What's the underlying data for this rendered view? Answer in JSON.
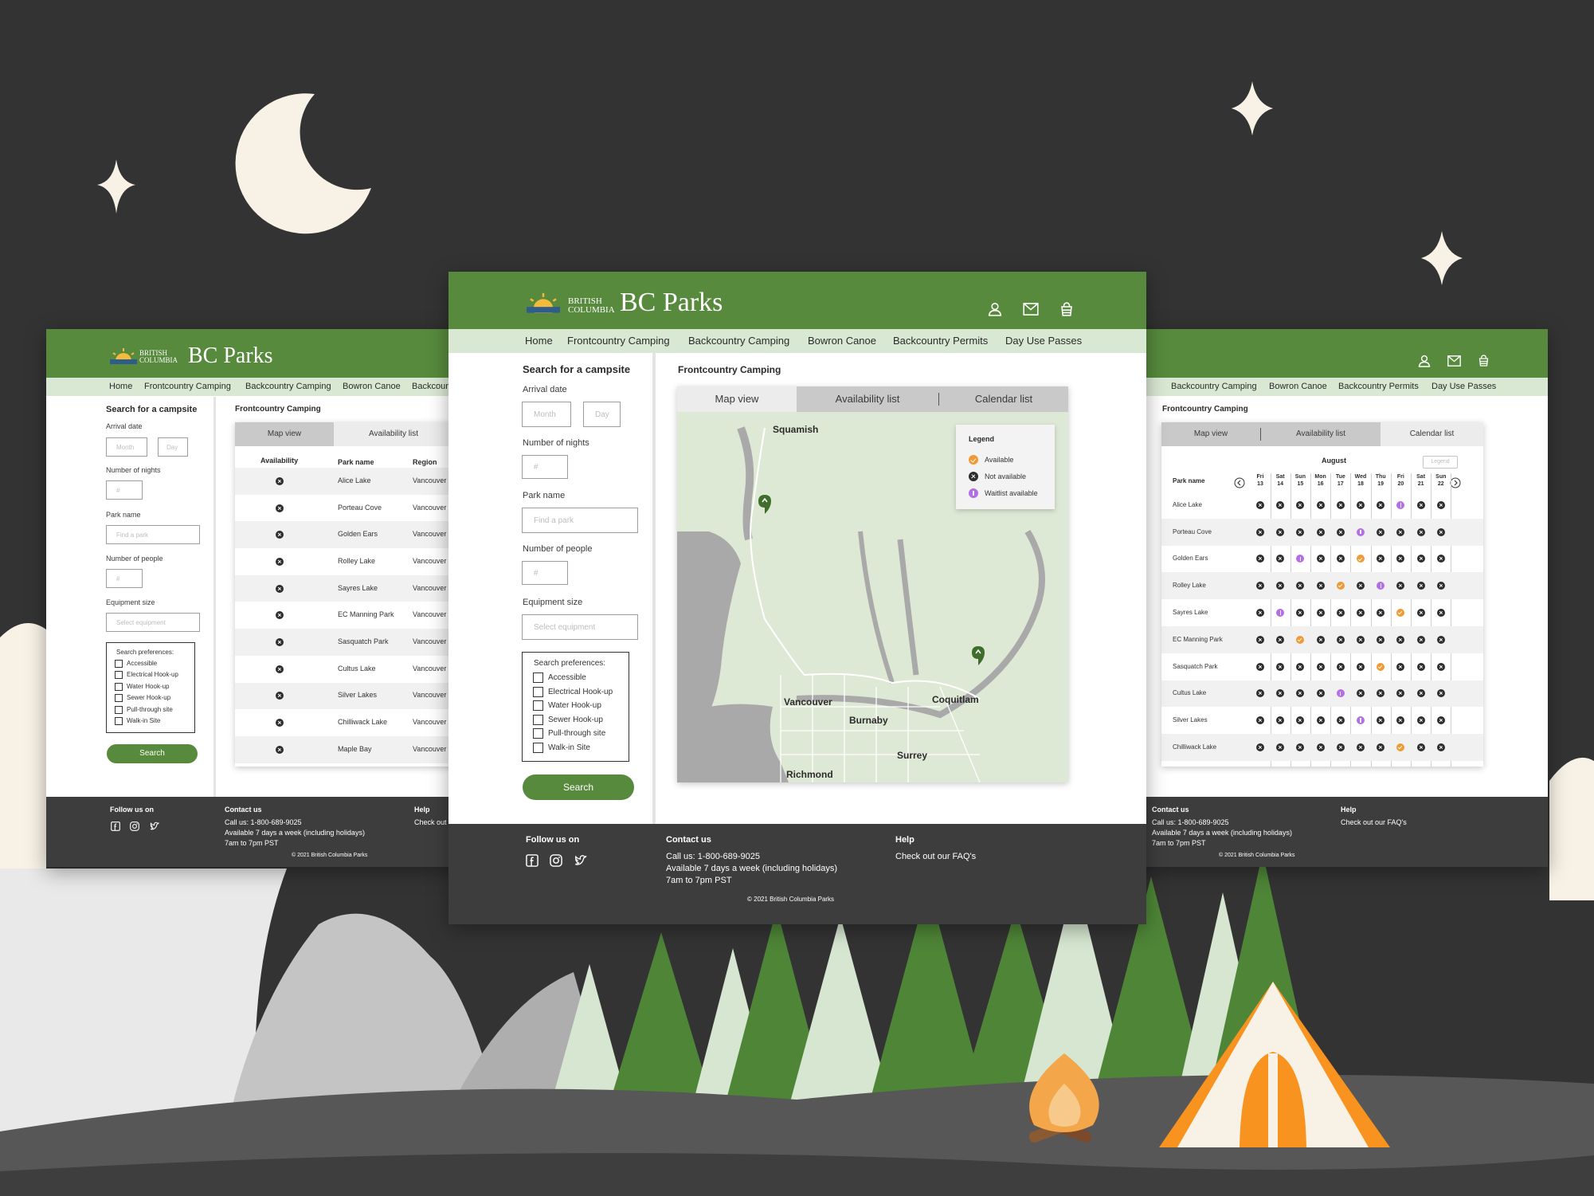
{
  "brand": {
    "logo_line1": "BRITISH",
    "logo_line2": "COLUMBIA",
    "name": "BC Parks",
    "primary_color": "#578a3c",
    "nav_bg_color": "#d9e8d3"
  },
  "nav": {
    "items": [
      "Home",
      "Frontcountry Camping",
      "Backcountry Camping",
      "Bowron Canoe",
      "Backcountry Permits",
      "Day Use Passes"
    ]
  },
  "header_icons": [
    "user-icon",
    "mail-icon",
    "cart-icon"
  ],
  "search": {
    "title": "Search for a campsite",
    "arrival_label": "Arrival date",
    "month_placeholder": "Month",
    "day_placeholder": "Day",
    "nights_label": "Number of nights",
    "nights_placeholder": "#",
    "park_label": "Park name",
    "park_placeholder": "Find a park",
    "people_label": "Number of people",
    "people_placeholder": "#",
    "equipment_label": "Equipment size",
    "equipment_placeholder": "Select equipment",
    "prefs_title": "Search preferences:",
    "prefs": [
      "Accessible",
      "Electrical Hook-up",
      "Water Hook-up",
      "Sewer Hook-up",
      "Pull-through site",
      "Walk-in Site"
    ],
    "button": "Search"
  },
  "main": {
    "section_title": "Frontcountry Camping",
    "tabs": [
      "Map view",
      "Availability list",
      "Calendar list"
    ]
  },
  "map": {
    "cities": [
      "Squamish",
      "Vancouver",
      "Burnaby",
      "Coquitlam",
      "Surrey",
      "Richmond"
    ]
  },
  "legend": {
    "title": "Legend",
    "items": [
      {
        "label": "Available",
        "status": "available",
        "color": "#f09a36"
      },
      {
        "label": "Not available",
        "status": "not-available",
        "color": "#2e2e2e"
      },
      {
        "label": "Waitlist available",
        "status": "waitlist",
        "color": "#b46ee6"
      }
    ]
  },
  "availability_list": {
    "headers": [
      "Availability",
      "Park name",
      "Region"
    ],
    "rows": [
      {
        "status": "not-available",
        "park": "Alice Lake",
        "region": "Vancouver"
      },
      {
        "status": "not-available",
        "park": "Porteau Cove",
        "region": "Vancouver"
      },
      {
        "status": "not-available",
        "park": "Golden Ears",
        "region": "Vancouver"
      },
      {
        "status": "not-available",
        "park": "Rolley Lake",
        "region": "Vancouver"
      },
      {
        "status": "not-available",
        "park": "Sayres Lake",
        "region": "Vancouver"
      },
      {
        "status": "not-available",
        "park": "EC Manning Park",
        "region": "Vancouver"
      },
      {
        "status": "not-available",
        "park": "Sasquatch Park",
        "region": "Vancouver"
      },
      {
        "status": "not-available",
        "park": "Cultus Lake",
        "region": "Vancouver"
      },
      {
        "status": "not-available",
        "park": "Silver Lakes",
        "region": "Vancouver"
      },
      {
        "status": "not-available",
        "park": "Chilliwack Lake",
        "region": "Vancouver"
      },
      {
        "status": "not-available",
        "park": "Maple Bay",
        "region": "Vancouver"
      }
    ]
  },
  "calendar": {
    "month": "August",
    "legend_button": "Legend",
    "park_header": "Park name",
    "days": [
      {
        "dow": "Fri",
        "num": "13"
      },
      {
        "dow": "Sat",
        "num": "14"
      },
      {
        "dow": "Sun",
        "num": "15"
      },
      {
        "dow": "Mon",
        "num": "16"
      },
      {
        "dow": "Tue",
        "num": "17"
      },
      {
        "dow": "Wed",
        "num": "18"
      },
      {
        "dow": "Thu",
        "num": "19"
      },
      {
        "dow": "Fri",
        "num": "20"
      },
      {
        "dow": "Sat",
        "num": "21"
      },
      {
        "dow": "Sun",
        "num": "22"
      }
    ],
    "rows": [
      {
        "park": "Alice Lake",
        "cells": [
          "x",
          "x",
          "x",
          "x",
          "x",
          "x",
          "x",
          "w",
          "x",
          "x"
        ]
      },
      {
        "park": "Porteau Cove",
        "cells": [
          "x",
          "x",
          "x",
          "x",
          "x",
          "w",
          "x",
          "x",
          "x",
          "x"
        ]
      },
      {
        "park": "Golden Ears",
        "cells": [
          "x",
          "x",
          "w",
          "x",
          "x",
          "a",
          "x",
          "x",
          "x",
          "x"
        ]
      },
      {
        "park": "Rolley Lake",
        "cells": [
          "x",
          "x",
          "x",
          "x",
          "a",
          "x",
          "w",
          "x",
          "x",
          "x"
        ]
      },
      {
        "park": "Sayres Lake",
        "cells": [
          "x",
          "w",
          "x",
          "x",
          "x",
          "x",
          "x",
          "a",
          "x",
          "x"
        ]
      },
      {
        "park": "EC Manning Park",
        "cells": [
          "x",
          "x",
          "a",
          "x",
          "x",
          "x",
          "x",
          "x",
          "x",
          "x"
        ]
      },
      {
        "park": "Sasquatch Park",
        "cells": [
          "x",
          "x",
          "x",
          "x",
          "x",
          "x",
          "a",
          "x",
          "x",
          "x"
        ]
      },
      {
        "park": "Cultus Lake",
        "cells": [
          "x",
          "x",
          "x",
          "x",
          "w",
          "x",
          "x",
          "x",
          "x",
          "x"
        ]
      },
      {
        "park": "Silver Lakes",
        "cells": [
          "x",
          "x",
          "x",
          "x",
          "x",
          "w",
          "x",
          "x",
          "x",
          "x"
        ]
      },
      {
        "park": "Chilliwack Lake",
        "cells": [
          "x",
          "x",
          "x",
          "x",
          "x",
          "x",
          "x",
          "a",
          "x",
          "x"
        ]
      }
    ]
  },
  "footer": {
    "follow_title": "Follow us on",
    "social_icons": [
      "facebook-icon",
      "instagram-icon",
      "twitter-icon"
    ],
    "contact_title": "Contact us",
    "contact_lines": [
      "Call us: 1-800-689-9025",
      "Available 7 days a week (including holidays)",
      "7am to 7pm PST"
    ],
    "help_title": "Help",
    "help_link": "Check out our FAQ's",
    "copyright": "2021 British Columbia Parks"
  }
}
